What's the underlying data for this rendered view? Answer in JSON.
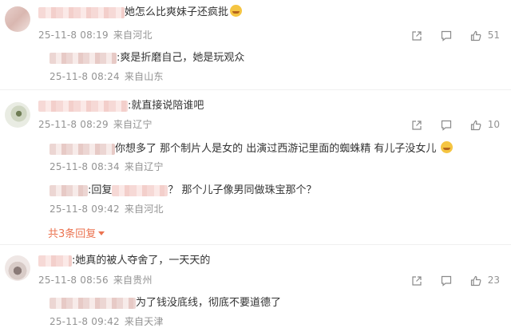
{
  "comments": [
    {
      "text": "她怎么比爽妹子还疯批",
      "date": "25-11-8 08:19",
      "location": "来自河北",
      "likes": "51",
      "replies": [
        {
          "text": ":爽是折磨自己，她是玩观众",
          "date": "25-11-8 08:24",
          "location": "来自山东"
        }
      ]
    },
    {
      "text": ":就直接说陪谁吧",
      "date": "25-11-8 08:29",
      "location": "来自辽宁",
      "likes": "10",
      "replies": [
        {
          "text": "你想多了 那个制片人是女的 出演过西游记里面的蜘蛛精 有儿子没女儿",
          "date": "25-11-8 08:34",
          "location": "来自辽宁"
        },
        {
          "prefix": ":回复",
          "text": "？ 那个儿子像男同做珠宝那个？",
          "date": "25-11-8 09:42",
          "location": "来自河北"
        }
      ],
      "more_replies": "共3条回复"
    },
    {
      "text": ":她真的被人夺舍了，一天天的",
      "date": "25-11-8 08:56",
      "location": "来自贵州",
      "likes": "23",
      "replies": [
        {
          "text": "为了钱没底线，彻底不要道德了",
          "date": "25-11-8 09:42",
          "location": "来自天津"
        }
      ]
    }
  ],
  "icons": {
    "share": "share-icon",
    "comment": "comment-icon",
    "like": "thumbs-up-icon"
  },
  "colors": {
    "meta": "#939393",
    "link": "#eb7350"
  }
}
